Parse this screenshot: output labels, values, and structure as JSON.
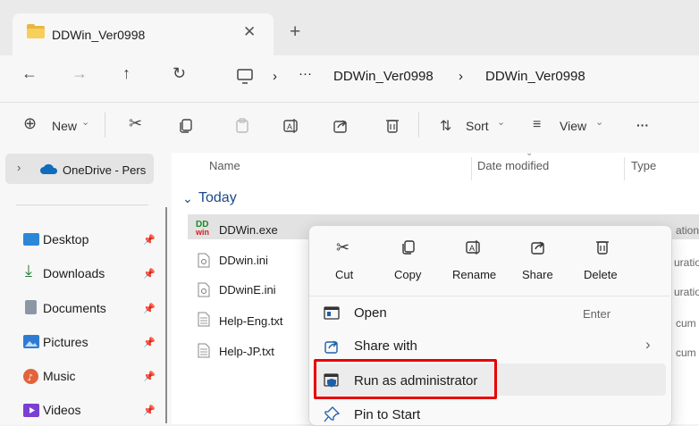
{
  "window": {
    "tab_title": "DDWin_Ver0998",
    "close_tab_glyph": "✕",
    "new_tab_glyph": "+"
  },
  "address": {
    "ellipsis": "···",
    "sep1": "›",
    "sep2": "›",
    "crumb1": "DDWin_Ver0998",
    "crumb2": "DDWin_Ver0998"
  },
  "toolbar": {
    "new_label": "New",
    "sort_label": "Sort",
    "view_label": "View",
    "more_label": "···",
    "caret": "⌄"
  },
  "sidebar": {
    "onedrive": "OneDrive - Pers",
    "items": [
      {
        "label": "Desktop",
        "icon": "desktop-icon",
        "color": "#2b88d8"
      },
      {
        "label": "Downloads",
        "icon": "download-icon",
        "color": "#1f7a3c"
      },
      {
        "label": "Documents",
        "icon": "documents-icon",
        "color": "#6d7a8c"
      },
      {
        "label": "Pictures",
        "icon": "pictures-icon",
        "color": "#2f7bd4"
      },
      {
        "label": "Music",
        "icon": "music-icon",
        "color": "#e3643c"
      },
      {
        "label": "Videos",
        "icon": "videos-icon",
        "color": "#7b3fd1"
      }
    ]
  },
  "columns": {
    "name": "Name",
    "date_modified": "Date modified",
    "type": "Type"
  },
  "group": {
    "today": "Today"
  },
  "files": [
    {
      "name": "DDWin.exe",
      "type_peek": "ation"
    },
    {
      "name": "DDwin.ini",
      "type_peek": "uratio"
    },
    {
      "name": "DDwinE.ini",
      "type_peek": "uratio"
    },
    {
      "name": "Help-Eng.txt",
      "type_peek": "cum"
    },
    {
      "name": "Help-JP.txt",
      "type_peek": "cum"
    }
  ],
  "context_menu": {
    "quick_actions": [
      {
        "label": "Cut",
        "icon": "cut-icon"
      },
      {
        "label": "Copy",
        "icon": "copy-icon"
      },
      {
        "label": "Rename",
        "icon": "rename-icon"
      },
      {
        "label": "Share",
        "icon": "share-icon"
      },
      {
        "label": "Delete",
        "icon": "delete-icon"
      }
    ],
    "open": "Open",
    "open_shortcut": "Enter",
    "share_with": "Share with",
    "run_as_admin": "Run as administrator",
    "pin_to_start": "Pin to Start",
    "submenu_arrow": "›"
  },
  "colors": {
    "highlight_box": "#e80000",
    "accent": "#1d5fa8"
  }
}
